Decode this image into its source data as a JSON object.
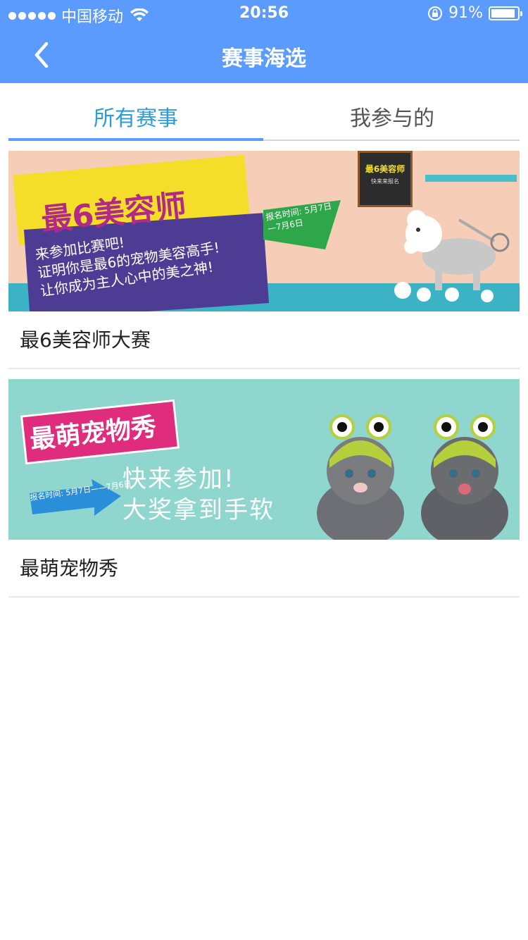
{
  "status_bar": {
    "carrier": "中国移动",
    "time": "20:56",
    "battery_percent": "91%",
    "battery_level": 0.91
  },
  "nav": {
    "title": "赛事海选",
    "back_icon": "chevron-left-icon"
  },
  "tabs": [
    {
      "label": "所有赛事",
      "active": true
    },
    {
      "label": "我参与的",
      "active": false
    }
  ],
  "colors": {
    "header": "#5b9bfd",
    "tab_active": "#2a9cd8",
    "tab_inactive": "#555555"
  },
  "contests": [
    {
      "title": "最6美容师大赛",
      "banner": {
        "headline": "最6美容师",
        "lines": [
          "来参加比赛吧!",
          "证明你是最6的宠物美容高手!",
          "让你成为主人心中的美之神!"
        ],
        "flag_text": "报名时间: 5月7日—7月6日",
        "board_title": "最6美容师",
        "board_sub": "快来来报名"
      }
    },
    {
      "title": "最萌宠物秀",
      "banner": {
        "headline": "最萌宠物秀",
        "arrow_text": "报名时间: 5月7日——7月6日",
        "slogan_1": "快来参加!",
        "slogan_2": "大奖拿到手软"
      }
    }
  ]
}
